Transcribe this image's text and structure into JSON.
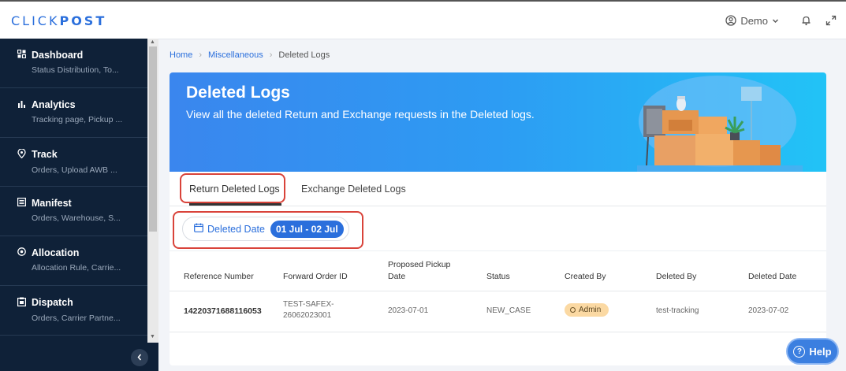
{
  "app": {
    "logo_light": "CLICK",
    "logo_bold": "POST"
  },
  "header": {
    "user_name": "Demo"
  },
  "sidebar": {
    "items": [
      {
        "label": "Dashboard",
        "sub": "Status Distribution, To...",
        "icon": "grid-icon"
      },
      {
        "label": "Analytics",
        "sub": "Tracking page, Pickup ...",
        "icon": "bar-chart-icon"
      },
      {
        "label": "Track",
        "sub": "Orders, Upload AWB ...",
        "icon": "location-pin-icon"
      },
      {
        "label": "Manifest",
        "sub": "Orders, Warehouse, S...",
        "icon": "document-icon"
      },
      {
        "label": "Allocation",
        "sub": "Allocation Rule, Carrie...",
        "icon": "target-icon"
      },
      {
        "label": "Dispatch",
        "sub": "Orders, Carrier Partne...",
        "icon": "clipboard-icon"
      }
    ]
  },
  "breadcrumb": {
    "home": "Home",
    "section": "Miscellaneous",
    "current": "Deleted Logs"
  },
  "hero": {
    "title": "Deleted Logs",
    "subtitle": "View all the deleted Return and Exchange requests in the Deleted logs."
  },
  "tabs": {
    "return": "Return Deleted Logs",
    "exchange": "Exchange Deleted Logs"
  },
  "filter": {
    "label": "Deleted Date",
    "value": "01 Jul - 02 Jul"
  },
  "table": {
    "headers": {
      "reference": "Reference Number",
      "forward": "Forward Order ID",
      "pickup_1": "Proposed Pickup",
      "pickup_2": "Date",
      "status": "Status",
      "created": "Created By",
      "deleted_by": "Deleted By",
      "deleted_date": "Deleted Date"
    },
    "rows": [
      {
        "reference": "14220371688116053",
        "forward_1": "TEST-SAFEX-",
        "forward_2": "26062023001",
        "pickup": "2023-07-01",
        "status": "NEW_CASE",
        "created": "Admin",
        "deleted_by": "test-tracking",
        "deleted_date": "2023-07-02"
      }
    ]
  },
  "help": {
    "label": "Help"
  },
  "colors": {
    "accent": "#2b6fdc",
    "sidebar": "#0f2138",
    "highlight": "#d9433a",
    "badge": "#fbd9a3"
  }
}
